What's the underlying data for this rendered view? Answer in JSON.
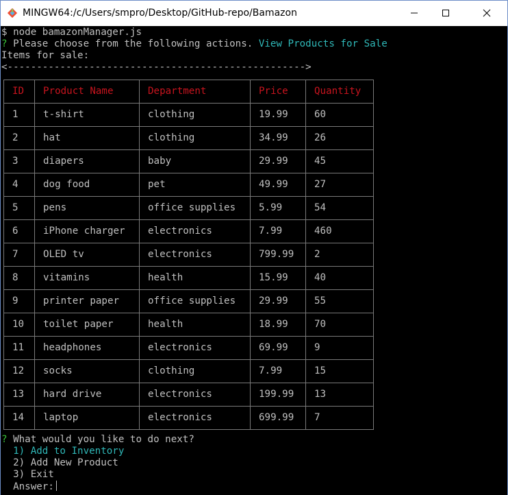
{
  "window": {
    "title": "MINGW64:/c/Users/smpro/Desktop/GitHub-repo/Bamazon",
    "icon": "git-bash-icon",
    "controls": [
      "minimize-icon",
      "maximize-icon",
      "close-icon"
    ]
  },
  "console": {
    "command_line": "$ node bamazonManager.js",
    "prompt_mark": "?",
    "question1": " Please choose from the following actions.",
    "answer1": " View Products for Sale",
    "items_heading": "Items for sale:",
    "arrow_line": "<--------------------------------------------------->",
    "question2_mark": "?",
    "question2": " What would you like to do next?",
    "menu": [
      "  1) Add to Inventory",
      "  2) Add New Product",
      "  3) Exit"
    ],
    "answer_prompt": "  Answer:"
  },
  "table": {
    "headers": [
      "ID",
      "Product Name",
      "Department",
      "Price",
      "Quantity"
    ],
    "rows": [
      [
        "1",
        "t-shirt",
        "clothing",
        "19.99",
        "60"
      ],
      [
        "2",
        "hat",
        "clothing",
        "34.99",
        "26"
      ],
      [
        "3",
        "diapers",
        "baby",
        "29.99",
        "45"
      ],
      [
        "4",
        "dog food",
        "pet",
        "49.99",
        "27"
      ],
      [
        "5",
        "pens",
        "office supplies",
        "5.99",
        "54"
      ],
      [
        "6",
        "iPhone charger",
        "electronics",
        "7.99",
        "460"
      ],
      [
        "7",
        "OLED tv",
        "electronics",
        "799.99",
        "2"
      ],
      [
        "8",
        "vitamins",
        "health",
        "15.99",
        "40"
      ],
      [
        "9",
        "printer paper",
        "office supplies",
        "29.99",
        "55"
      ],
      [
        "10",
        "toilet paper",
        "health",
        "18.99",
        "70"
      ],
      [
        "11",
        "headphones",
        "electronics",
        "69.99",
        "9"
      ],
      [
        "12",
        "socks",
        "clothing",
        "7.99",
        "15"
      ],
      [
        "13",
        "hard drive",
        "electronics",
        "199.99",
        "13"
      ],
      [
        "14",
        "laptop",
        "electronics",
        "699.99",
        "7"
      ]
    ]
  },
  "colors": {
    "prompt_green": "#39c139",
    "answer_cyan": "#2fb8b8",
    "header_red": "#c8141e",
    "text_gray": "#c0c0c0",
    "background": "#000000"
  }
}
